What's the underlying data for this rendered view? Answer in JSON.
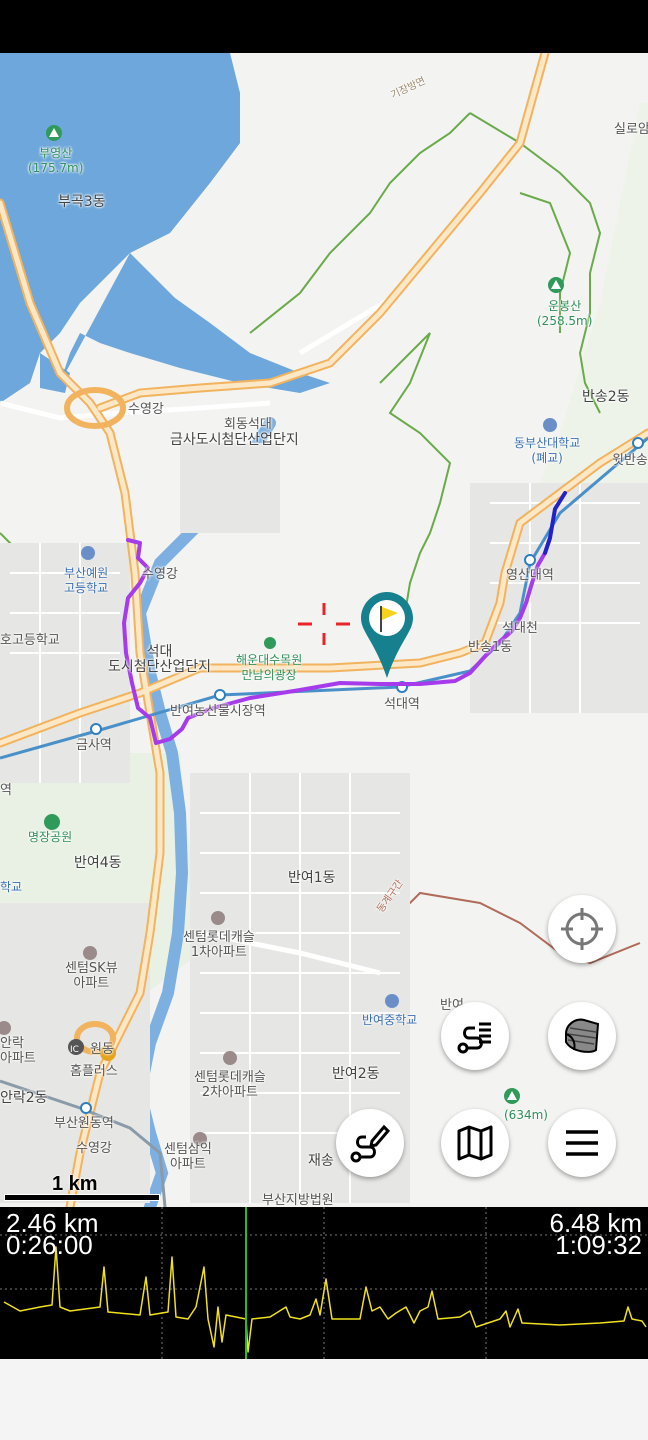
{
  "map": {
    "labels": {
      "mountain_buyeong": "부영산",
      "mountain_buyeong_height": "(175.7m)",
      "bugok3": "부곡3동",
      "mountain_unbong": "운봉산",
      "mountain_unbong_height": "(258.5m)",
      "silro": "실로암",
      "bansong2": "반송2동",
      "dongbusan_univ": "동부산대학교",
      "dongbusan_univ_note": "(폐교)",
      "witbansong": "윗반송",
      "suyeonggang_1": "수영강",
      "hoedong_seokdae": "회동석대",
      "geumsa_complex": "금사도시첨단산업단지",
      "busan_yeil": "부산예원",
      "busan_yeil_2": "고등학교",
      "suyeonggang_2": "수영강",
      "yeongsan_univ": "영산대역",
      "seokdaecheon": "석대천",
      "banyeo1_top": "반송1동",
      "haeun_arboretum": "해운대수목원",
      "mannam_square": "만남의광장",
      "seokdae_complex_1": "석대",
      "seokdae_complex_2": "도시첨단산업단지",
      "ho_high": "호고등학교",
      "banyeo_market_station": "반여농산물시장역",
      "seokdae_station": "석대역",
      "geumsa_station": "금사역",
      "yeok": "역",
      "myeongjang_park": "명장공원",
      "banyeo4": "반여4동",
      "hakgyo": "학교",
      "banyeo1": "반여1동",
      "centum_lotte1": "센텀롯데캐슬",
      "centum_lotte1_2": "1차아파트",
      "centum_sk": "센텀SK뷰",
      "centum_sk_2": "아파트",
      "banyeo_middle": "반여중학교",
      "banyeo_c": "반여",
      "anrak": "안락",
      "anrak_apt": "아파트",
      "homeplus": "홈플러스",
      "won": "원동",
      "centum_lotte2": "센텀롯데캐슬",
      "centum_lotte2_2": "2차아파트",
      "banyeo2": "반여2동",
      "anrak2": "안락2동",
      "busan_wondong": "부산원동역",
      "suyeonggang_3": "수영강",
      "centum_samik": "센텀삼익",
      "centum_samik_2": "아파트",
      "jaesong": "재송",
      "busan_court": "부산지방법원",
      "mountain_634": "(634m)",
      "road_ic": "IC",
      "highway_name": "기장방면",
      "border": "동계구간"
    },
    "scale_label": "1 km",
    "colors": {
      "track": "#a53bea",
      "track_end": "#2222cc",
      "water": "#5e9fd8",
      "highway": "#f4c07a",
      "green_line": "#6aaa4a",
      "marker": "#17808f",
      "flag": "#f7d21c",
      "crosshair": "#e8242a"
    }
  },
  "buttons": {
    "locate_icon": "crosshair-icon",
    "track_list_icon": "route-list-icon",
    "layers_icon": "layers-icon",
    "record_icon": "route-edit-icon",
    "map_icon": "map-icon",
    "menu_icon": "hamburger-icon"
  },
  "profile": {
    "left_distance": "2.46 km",
    "left_time": "0:26:00",
    "right_distance": "6.48 km",
    "right_time": "1:09:32",
    "cursor_fraction": 0.38,
    "line_color": "#f0e020",
    "cursor_color": "#22c022"
  }
}
